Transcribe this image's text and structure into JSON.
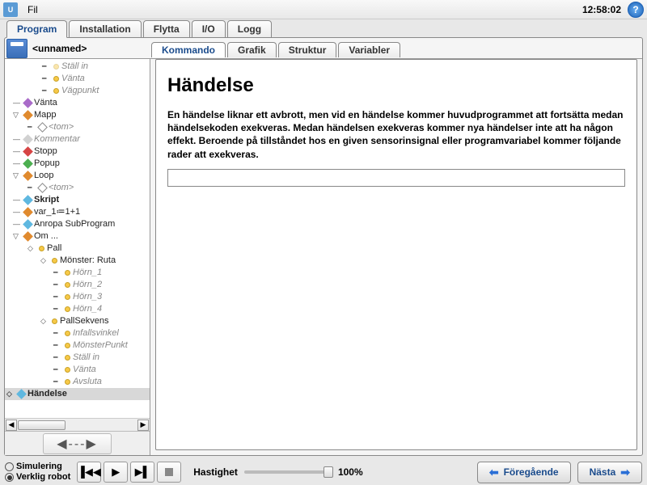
{
  "menubar": {
    "fil": "Fil",
    "clock": "12:58:02"
  },
  "mainTabs": {
    "program": "Program",
    "installation": "Installation",
    "flytta": "Flytta",
    "io": "I/O",
    "logg": "Logg"
  },
  "file": {
    "name": "<unnamed>"
  },
  "subTabs": {
    "kommando": "Kommando",
    "grafik": "Grafik",
    "struktur": "Struktur",
    "variabler": "Variabler"
  },
  "content": {
    "title": "Händelse",
    "desc": "En händelse liknar ett avbrott, men vid en händelse kommer huvudprogrammet att fortsätta medan händelsekoden exekveras. Medan händelsen exekveras kommer nya händelser inte att ha någon effekt. Beroende på tillståndet hos en given sensorinsignal eller programvariabel kommer följande rader att exekveras."
  },
  "tree": {
    "stallIn": "Ställ in",
    "vanta": "Vänta",
    "vagpunkt": "Vägpunkt",
    "mapp": "Mapp",
    "tom": "<tom>",
    "kommentar": "Kommentar",
    "stopp": "Stopp",
    "popup": "Popup",
    "loop": "Loop",
    "skript": "Skript",
    "var1": "var_1≔1+1",
    "anropa": "Anropa SubProgram",
    "om": "Om ...",
    "pall": "Pall",
    "monster": "Mönster: Ruta",
    "horn1": "Hörn_1",
    "horn2": "Hörn_2",
    "horn3": "Hörn_3",
    "horn4": "Hörn_4",
    "pallsekvens": "PallSekvens",
    "infalls": "Infallsvinkel",
    "monsterpunkt": "MönsterPunkt",
    "avsluta": "Avsluta",
    "handelse": "Händelse"
  },
  "bottom": {
    "sim": "Simulering",
    "real": "Verklig robot",
    "speedLabel": "Hastighet",
    "speedVal": "100%",
    "prev": "Föregående",
    "next": "Nästa"
  }
}
